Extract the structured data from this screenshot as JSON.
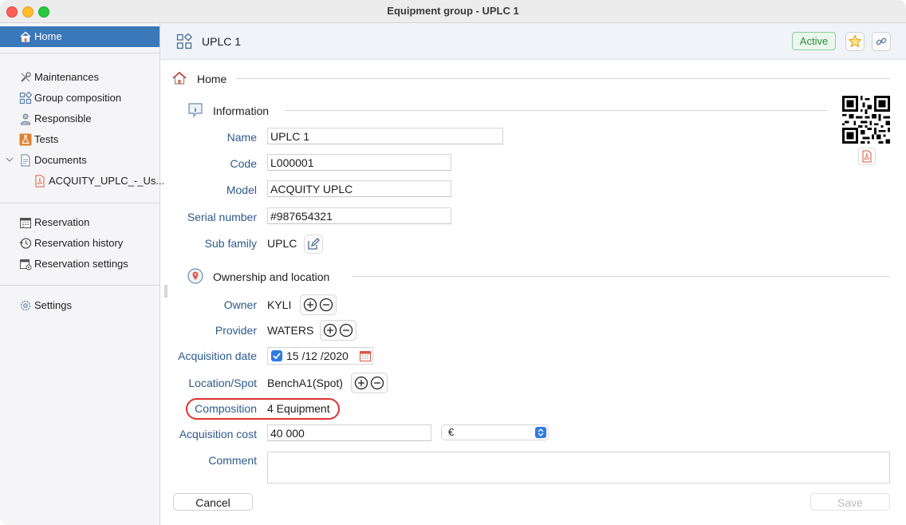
{
  "window": {
    "title": "Equipment group - UPLC 1"
  },
  "sidebar": {
    "home": "Home",
    "items": [
      "Maintenances",
      "Group composition",
      "Responsible",
      "Tests",
      "Documents"
    ],
    "document_file": "ACQUITY_UPLC_-_Us...",
    "reservation_items": [
      "Reservation",
      "Reservation history",
      "Reservation settings"
    ],
    "settings": "Settings"
  },
  "header": {
    "title": "UPLC 1",
    "status": "Active",
    "status_color": "#2e8a3e"
  },
  "breadcrumb": {
    "home": "Home"
  },
  "information": {
    "title": "Information",
    "name_label": "Name",
    "name_value": "UPLC 1",
    "code_label": "Code",
    "code_value": "L000001",
    "model_label": "Model",
    "model_value": "ACQUITY UPLC",
    "serial_label": "Serial number",
    "serial_value": "#987654321",
    "subfamily_label": "Sub family",
    "subfamily_value": "UPLC"
  },
  "ownership": {
    "title": "Ownership and location",
    "owner_label": "Owner",
    "owner_value": "KYLI",
    "provider_label": "Provider",
    "provider_value": "WATERS",
    "acq_date_label": "Acquisition date",
    "acq_date_value": "15 /12 /2020",
    "location_label": "Location/Spot",
    "location_value": "BenchA1(Spot)",
    "composition_label": "Composition",
    "composition_value": "4 Equipment",
    "acq_cost_label": "Acquisition cost",
    "acq_cost_value": "40 000",
    "currency_value": "€",
    "comment_label": "Comment",
    "comment_value": ""
  },
  "footer": {
    "cancel": "Cancel",
    "save": "Save"
  },
  "colors": {
    "accent": "#3a78b9",
    "label": "#2c5a8a",
    "highlight": "#e03131"
  }
}
